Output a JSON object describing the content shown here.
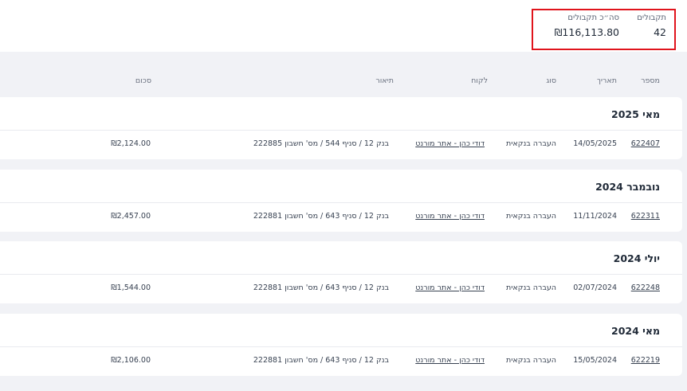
{
  "summary": {
    "count_label": "תקבולים",
    "count_value": "42",
    "total_label": "סה״כ תקבולים",
    "total_value": "₪116,113.80"
  },
  "columns": {
    "number": "מספר",
    "date": "תאריך",
    "type": "סוג",
    "client": "לקוח",
    "description": "תיאור",
    "amount": "סכום"
  },
  "groups": [
    {
      "title": "מאי 2025",
      "rows": [
        {
          "number": "622407",
          "date": "14/05/2025",
          "type": "העברה בנקאית",
          "client": "דודי כהן - אתר מורנט",
          "description": "בנק 12 / סניף 544 / מס' חשבון 222885",
          "amount": "₪2,124.00"
        }
      ]
    },
    {
      "title": "נובמבר 2024",
      "rows": [
        {
          "number": "622311",
          "date": "11/11/2024",
          "type": "העברה בנקאית",
          "client": "דודי כהן - אתר מורנט",
          "description": "בנק 12 / סניף 643 / מס' חשבון 222881",
          "amount": "₪2,457.00"
        }
      ]
    },
    {
      "title": "יולי 2024",
      "rows": [
        {
          "number": "622248",
          "date": "02/07/2024",
          "type": "העברה בנקאית",
          "client": "דודי כהן - אתר מורנט",
          "description": "בנק 12 / סניף 643 / מס' חשבון 222881",
          "amount": "₪1,544.00"
        }
      ]
    },
    {
      "title": "מאי 2024",
      "rows": [
        {
          "number": "622219",
          "date": "15/05/2024",
          "type": "העברה בנקאית",
          "client": "דודי כהן - אתר מורנט",
          "description": "בנק 12 / סניף 643 / מס' חשבון 222881",
          "amount": "₪2,106.00"
        }
      ]
    }
  ]
}
